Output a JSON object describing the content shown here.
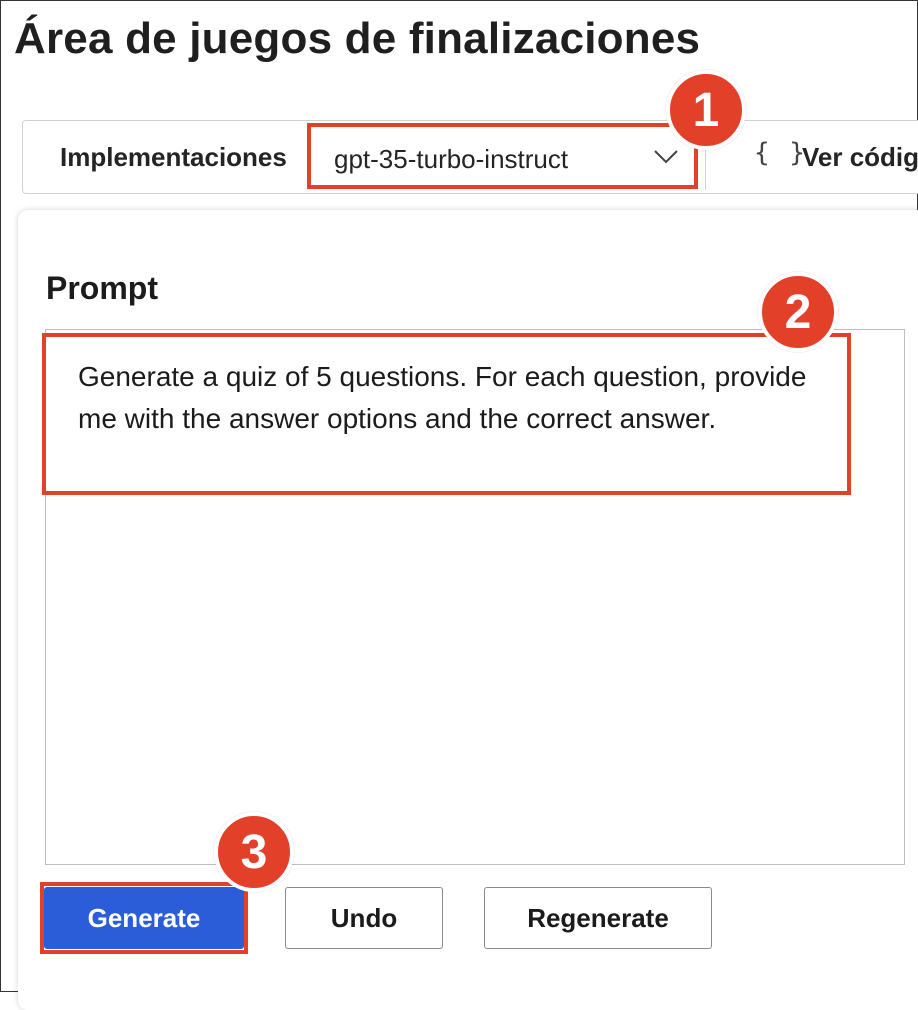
{
  "page": {
    "title": "Área de juegos de finalizaciones"
  },
  "toolbar": {
    "deployments_label": "Implementaciones",
    "deployment_value": "gpt-35-turbo-instruct",
    "view_code_icon": "{ }",
    "view_code_label": "Ver códig"
  },
  "prompt": {
    "heading": "Prompt",
    "text": "Generate a quiz of 5 questions. For each question, provide me with the answer options and the correct answer."
  },
  "actions": {
    "generate_label": "Generate",
    "undo_label": "Undo",
    "regenerate_label": "Regenerate"
  },
  "callouts": {
    "step1": "1",
    "step2": "2",
    "step3": "3"
  },
  "colors": {
    "accent": "#2b5dd9",
    "highlight": "#e3402a"
  }
}
